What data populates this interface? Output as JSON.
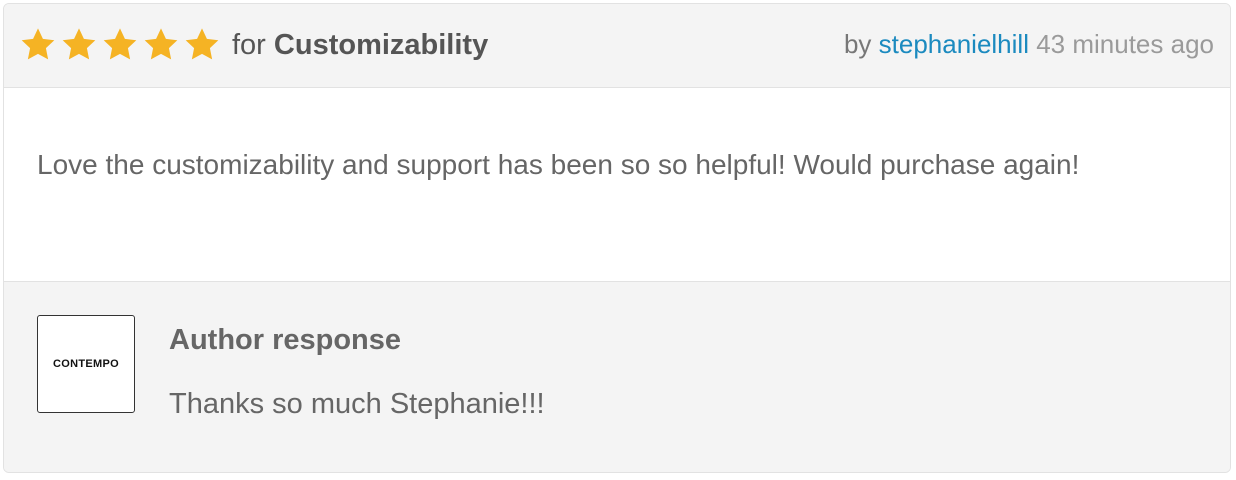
{
  "review": {
    "rating": 5,
    "rating_max": 5,
    "star_color": "#f5b324",
    "for_label": "for",
    "category": "Customizability",
    "by_label": "by",
    "username": "stephanielhill",
    "time_ago": "43 minutes ago",
    "username_color": "#1b8abf",
    "text": "Love the customizability and support has been so so helpful! Would purchase again!"
  },
  "author_response": {
    "logo_text": "CONTEMPO",
    "title": "Author response",
    "text": "Thanks so much Stephanie!!!"
  }
}
